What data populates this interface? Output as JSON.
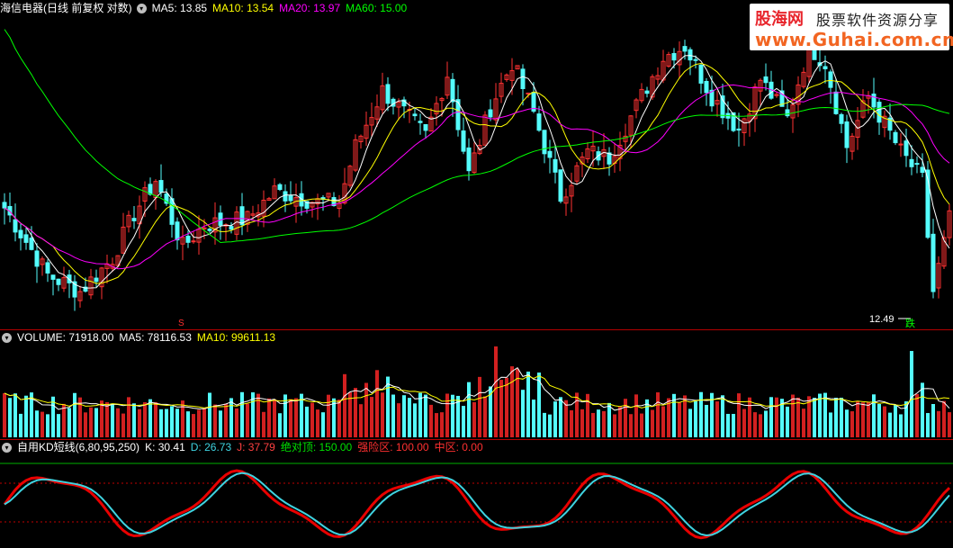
{
  "panels": {
    "price": {
      "title": "海信电器(日线 前复权 对数)",
      "ma5": "MA5: 13.85",
      "ma10": "MA10: 13.54",
      "ma20": "MA20: 13.97",
      "ma60": "MA60: 15.00",
      "low_label": "12.49",
      "marker_fall": "跌",
      "marker_s": "S"
    },
    "volume": {
      "title": "VOLUME: 71918.00",
      "ma5": "MA5: 78116.53",
      "ma10": "MA10: 99611.13"
    },
    "kd": {
      "title": "自用KD短线(6,80,95,250)",
      "k": "K: 30.41",
      "d": "D: 26.73",
      "j": "J: 37.79",
      "top": "绝对顶: 150.00",
      "risk": "强险区: 100.00",
      "mid": "中区: 0.00"
    }
  },
  "watermark": {
    "logo": "股海网",
    "slogan": "股票软件资源分享",
    "url": "www.Guhai.com.cn"
  },
  "colors": {
    "up": "#ff3232",
    "down": "#54fcfc",
    "ma5": "#ffffff",
    "ma10": "#ffff00",
    "ma20": "#ff00ff",
    "ma60": "#00ff00",
    "divider": "#b30000",
    "k_line": "#e80000",
    "d_line": "#3fd3e0",
    "top_line": "#00b000"
  },
  "chart_data": [
    {
      "type": "candlestick",
      "title": "海信电器(日线 前复权 对数)",
      "series_labels": [
        "MA5",
        "MA10",
        "MA20",
        "MA60"
      ],
      "latest": {
        "MA5": 13.85,
        "MA10": 13.54,
        "MA20": 13.97,
        "MA60": 15.0
      },
      "annotated_low": 12.49,
      "grid": false
    },
    {
      "type": "bar",
      "title": "VOLUME",
      "latest": {
        "VOLUME": 71918.0,
        "MA5": 78116.53,
        "MA10": 99611.13
      }
    },
    {
      "type": "line",
      "title": "自用KD短线(6,80,95,250)",
      "latest": {
        "K": 30.41,
        "D": 26.73,
        "J": 37.79
      },
      "reference_lines": {
        "绝对顶": 150.0,
        "强险区": 100.0,
        "中区": 0.0
      }
    }
  ]
}
